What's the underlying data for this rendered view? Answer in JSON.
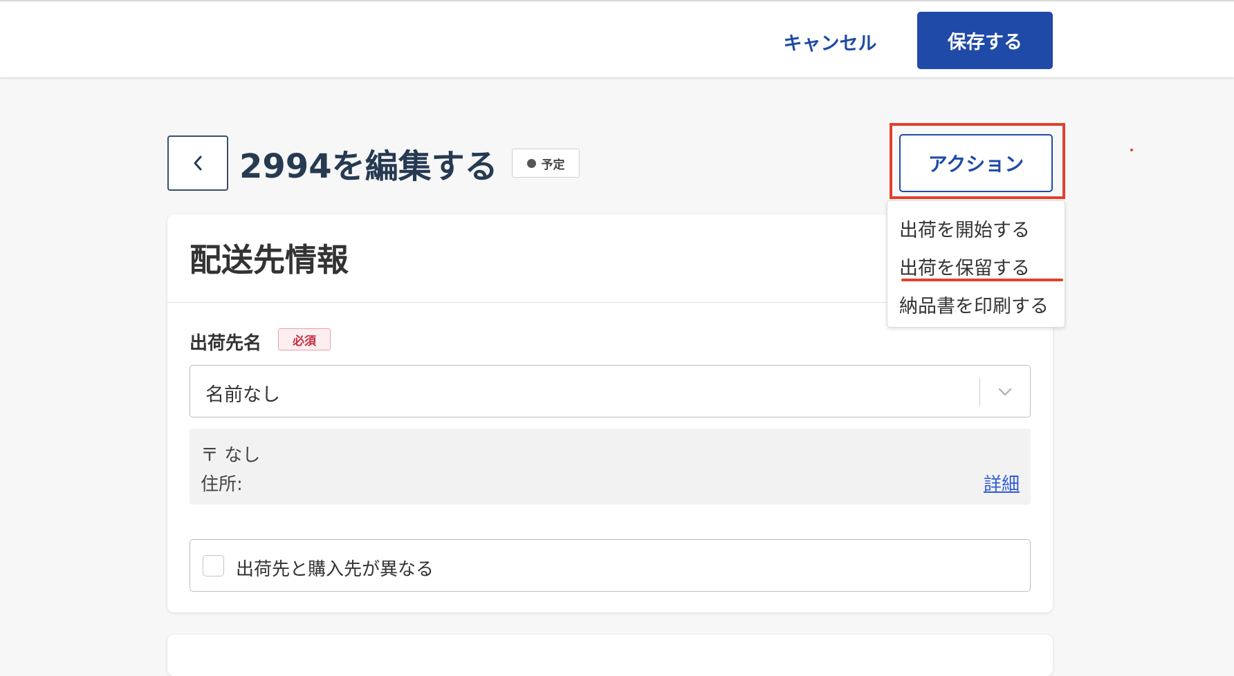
{
  "header": {
    "cancel_label": "キャンセル",
    "save_label": "保存する"
  },
  "page": {
    "title": "2994を編集する",
    "status": "予定",
    "action_label": "アクション"
  },
  "action_menu": {
    "items": [
      {
        "label": "出荷を開始する"
      },
      {
        "label": "出荷を保留する"
      },
      {
        "label": "納品書を印刷する"
      }
    ]
  },
  "shipping_card": {
    "title": "配送先情報",
    "field_label": "出荷先名",
    "required_label": "必須",
    "selected_value": "名前なし",
    "postal": "〒 なし",
    "address": "住所:",
    "detail_link": "詳細",
    "different_buyer_label": "出荷先と購入先が異なる",
    "different_buyer_checked": false
  },
  "colors": {
    "primary": "#1f4aa8",
    "annotation": "#e0412c",
    "required": "#c23040",
    "link": "#2f5bd6"
  }
}
